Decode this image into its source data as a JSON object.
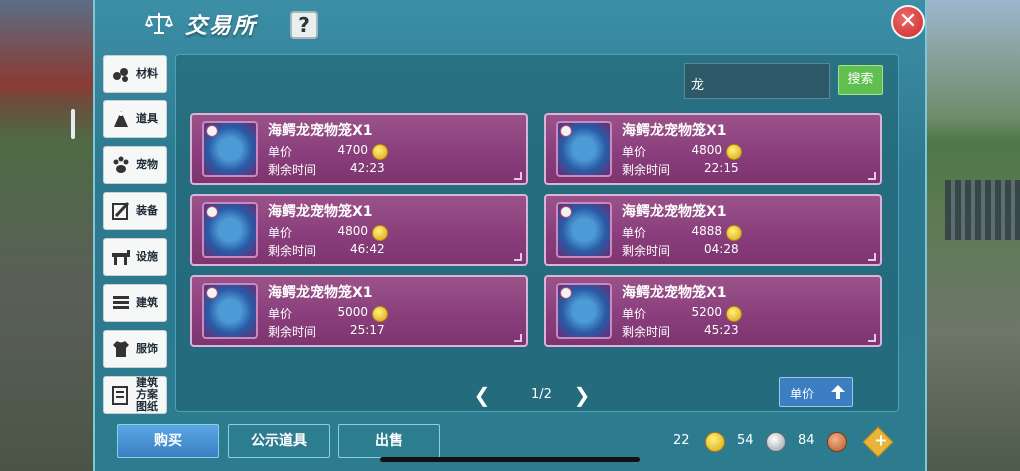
{
  "window": {
    "title": "交易所",
    "help_label": "?",
    "close_label": "✕"
  },
  "sidebar": {
    "items": [
      {
        "label": "材料",
        "icon": "materials-icon"
      },
      {
        "label": "道具",
        "icon": "item-icon"
      },
      {
        "label": "宠物",
        "icon": "paw-icon"
      },
      {
        "label": "装备",
        "icon": "equipment-icon"
      },
      {
        "label": "设施",
        "icon": "facility-icon"
      },
      {
        "label": "建筑",
        "icon": "building-icon"
      },
      {
        "label": "服饰",
        "icon": "clothing-icon"
      },
      {
        "label": "建筑方案图纸",
        "icon": "blueprint-icon"
      }
    ]
  },
  "search": {
    "value": "龙",
    "button_label": "搜索"
  },
  "listing_labels": {
    "price_label": "单价",
    "time_label": "剩余时间"
  },
  "listings": [
    {
      "name": "海鳄龙宠物笼X1",
      "price": "4700",
      "time": "42:23"
    },
    {
      "name": "海鳄龙宠物笼X1",
      "price": "4800",
      "time": "22:15"
    },
    {
      "name": "海鳄龙宠物笼X1",
      "price": "4800",
      "time": "46:42"
    },
    {
      "name": "海鳄龙宠物笼X1",
      "price": "4888",
      "time": "04:28"
    },
    {
      "name": "海鳄龙宠物笼X1",
      "price": "5000",
      "time": "25:17"
    },
    {
      "name": "海鳄龙宠物笼X1",
      "price": "5200",
      "time": "45:23"
    }
  ],
  "pagination": {
    "prev": "❮",
    "next": "❯",
    "page": "1/2"
  },
  "sort": {
    "label": "单价"
  },
  "bottom_tabs": {
    "buy": "购买",
    "public": "公示道具",
    "sell": "出售"
  },
  "currency": {
    "gold": "22",
    "silver": "54",
    "copper": "84",
    "add": "+"
  },
  "colors": {
    "card": "#8a3f7c",
    "buy_tab": "#3a7fc4",
    "search_button": "#5fbf4f",
    "close": "#c92b2b"
  }
}
